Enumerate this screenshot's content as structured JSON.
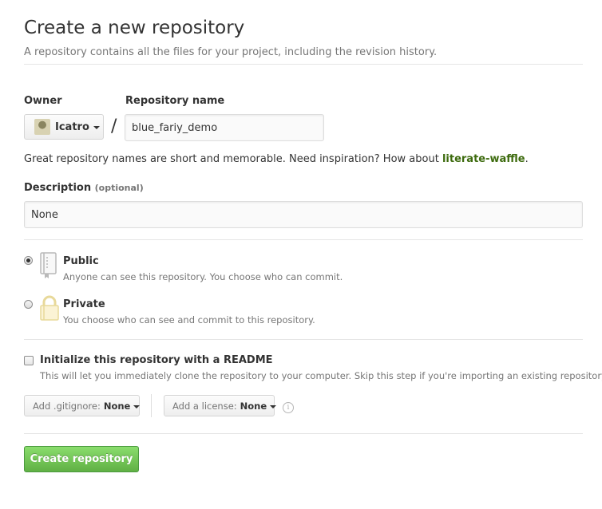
{
  "header": {
    "title": "Create a new repository",
    "subtitle": "A repository contains all the files for your project, including the revision history."
  },
  "owner": {
    "label": "Owner",
    "name": "Icatro"
  },
  "repo_name": {
    "label": "Repository name",
    "value": "blue_fariy_demo",
    "separator": "/"
  },
  "hint": {
    "prefix": "Great repository names are short and memorable. Need inspiration? How about ",
    "suggestion": "literate-waffle",
    "suffix": "."
  },
  "description": {
    "label": "Description",
    "optional": "(optional)",
    "value": "None"
  },
  "visibility": {
    "public": {
      "title": "Public",
      "desc": "Anyone can see this repository. You choose who can commit.",
      "selected": true
    },
    "private": {
      "title": "Private",
      "desc": "You choose who can see and commit to this repository.",
      "selected": false
    }
  },
  "readme": {
    "label": "Initialize this repository with a README",
    "desc": "This will let you immediately clone the repository to your computer. Skip this step if you're importing an existing repository.",
    "checked": false
  },
  "gitignore": {
    "label": "Add .gitignore:",
    "value": "None"
  },
  "license": {
    "label": "Add a license:",
    "value": "None"
  },
  "info_glyph": "i",
  "create_button": {
    "label": "Create repository"
  },
  "colors": {
    "accent_green": "#60b044",
    "suggestion_green": "#3d6b0e"
  }
}
